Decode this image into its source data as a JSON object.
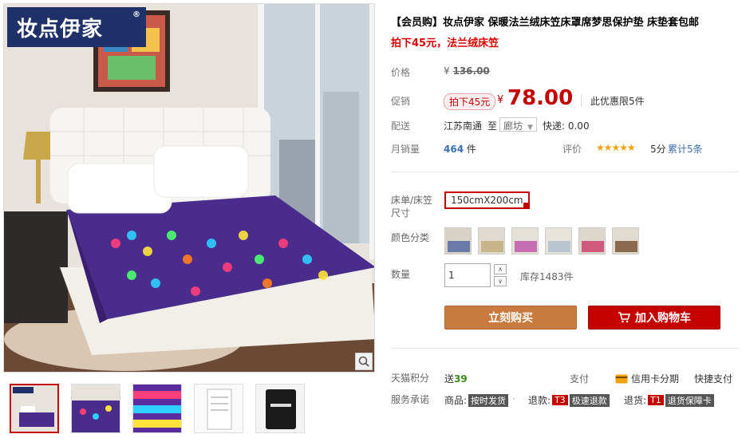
{
  "brand": {
    "logo_text": "妆点伊家",
    "registered": "®"
  },
  "product": {
    "title": "【会员购】妆点伊家 保暖法兰绒床笠床罩席梦思保护垫 床垫套包邮",
    "subtitle": "拍下45元，法兰绒床笠"
  },
  "price": {
    "label": "价格",
    "currency": "¥",
    "original": "136.00",
    "promo_label": "促销",
    "promo_tag": "拍下45元",
    "current": "78.00",
    "limit_text": "此优惠限5件"
  },
  "shipping": {
    "label": "配送",
    "from": "江苏南通",
    "to_word": "至",
    "destination": "廊坊",
    "fee": "快递: 0.00"
  },
  "sales": {
    "label": "月销量",
    "count": "464",
    "unit": "件",
    "rating_label": "评价",
    "stars": "★★★★★",
    "score": "5分",
    "review_count": "累计5条"
  },
  "sku": {
    "size_label": "床单/床笠尺寸",
    "size_value": "150cmX200cm",
    "color_label": "颜色分类",
    "qty_label": "数量",
    "qty_value": "1",
    "stock": "库存1483件"
  },
  "buttons": {
    "buy": "立刻购买",
    "cart": "加入购物车"
  },
  "extras": {
    "points_label": "天猫积分",
    "points_prefix": "送",
    "points_value": "39",
    "pay_label": "支付",
    "credit": "信用卡分期",
    "quick": "快捷支付",
    "service_label": "服务承诺",
    "svc1_prefix": "商品:",
    "svc1_badge": "按时发货",
    "svc2_prefix": "退款:",
    "svc2_code": "T3",
    "svc2_badge": "极速退款",
    "svc3_prefix": "退货:",
    "svc3_code": "T1",
    "svc3_badge": "退货保障卡"
  },
  "colors": {
    "accent": "#c40000",
    "buy_button": "#c97a3f",
    "link": "#3a6db0"
  }
}
